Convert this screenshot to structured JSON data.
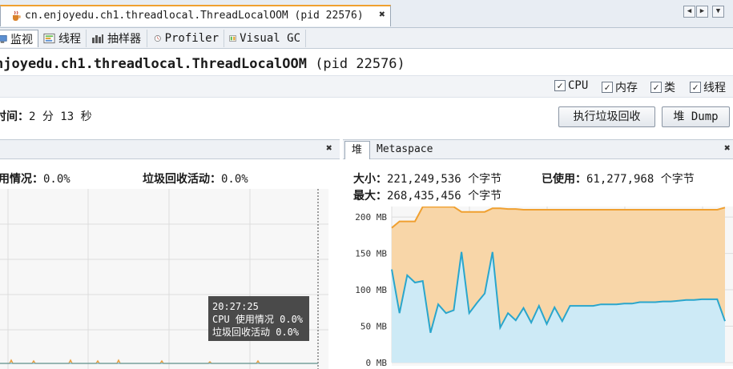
{
  "doc_tab": {
    "title": "cn.enjoyedu.ch1.threadlocal.ThreadLocalOOM (pid 22576)",
    "close": "✖"
  },
  "nav": {
    "prev": "◀",
    "next": "▶",
    "menu": "▼"
  },
  "sub_tabs": [
    {
      "label": "监视",
      "icon": "monitor-icon"
    },
    {
      "label": "线程",
      "icon": "threads-icon"
    },
    {
      "label": "抽样器",
      "icon": "sampler-icon"
    },
    {
      "label": "Profiler",
      "icon": "profiler-icon"
    },
    {
      "label": "Visual GC",
      "icon": "visual-gc-icon"
    }
  ],
  "header": {
    "title_main": "njoyedu.ch1.threadlocal.ThreadLocalOOM",
    "title_pid": "(pid 22576)"
  },
  "options": {
    "cpu": "CPU",
    "memory": "内存",
    "classes": "类",
    "threads": "线程",
    "check": "✓"
  },
  "uptime": {
    "label": "时间：",
    "value": "2 分 13 秒"
  },
  "buttons": {
    "gc": "执行垃圾回收",
    "heap_dump": "堆 Dump"
  },
  "cpu_panel": {
    "close": "✖",
    "usage_label": "用情况：",
    "usage_value": "0.0%",
    "gc_label": "垃圾回收活动：",
    "gc_value": "0.0%",
    "tooltip": {
      "time": "20:27:25",
      "cpu": "CPU 使用情况  0.0%",
      "gc": "垃圾回收活动  0.0%"
    },
    "colors": {
      "cpu": "#e8a040",
      "gc": "#3fa0c8"
    }
  },
  "heap_panel": {
    "tabs": [
      "堆",
      "Metaspace"
    ],
    "close": "✖",
    "size_label": "大小：",
    "size_value": "221,249,536 个字节",
    "used_label": "已使用：",
    "used_value": "61,277,968 个字节",
    "max_label": "最大：",
    "max_value": "268,435,456 个字节",
    "colors": {
      "size_line": "#f0a030",
      "size_fill": "#f8d6a8",
      "used_line": "#2aa6cc",
      "used_fill": "#cdeaf6"
    }
  },
  "chart_data": {
    "type": "area",
    "ylabel": "MB",
    "yticks": [
      "0 MB",
      "50 MB",
      "100 MB",
      "150 MB",
      "200 MB"
    ],
    "ylim": [
      0,
      210
    ],
    "grid": true,
    "series": [
      {
        "name": "大小",
        "values": [
          185,
          194,
          194,
          194,
          214,
          214,
          214,
          214,
          214,
          207,
          207,
          207,
          207,
          212,
          212,
          211,
          211,
          210,
          210,
          210,
          210,
          210,
          210,
          210,
          210,
          210,
          210,
          210,
          210,
          210,
          210,
          210,
          210,
          210,
          210,
          210,
          210,
          210,
          210,
          210,
          210,
          210,
          210,
          213
        ]
      },
      {
        "name": "已使用",
        "values": [
          128,
          68,
          120,
          110,
          112,
          41,
          80,
          68,
          72,
          152,
          68,
          82,
          95,
          152,
          48,
          68,
          58,
          75,
          55,
          78,
          53,
          76,
          57,
          78,
          78,
          78,
          78,
          80,
          80,
          80,
          81,
          81,
          83,
          83,
          83,
          84,
          84,
          85,
          86,
          86,
          87,
          87,
          87,
          57
        ]
      }
    ]
  }
}
